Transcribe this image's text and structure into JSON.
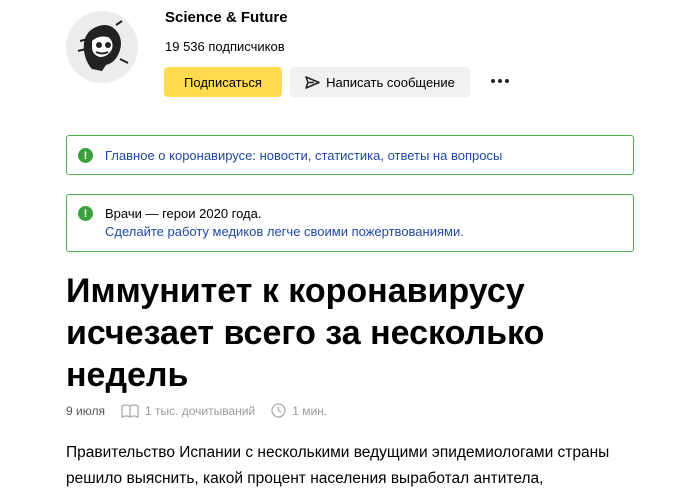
{
  "channel": {
    "name": "Science & Future",
    "subscribers": "19 536 подписчиков",
    "subscribe_label": "Подписаться",
    "message_label": "Написать сообщение"
  },
  "notices": [
    {
      "link": "Главное о коронавирусе: новости, статистика, ответы на вопросы"
    },
    {
      "text": "Врачи — герои 2020 года.",
      "link": "Сделайте работу медиков легче своими пожертвованиями."
    }
  ],
  "article": {
    "title": "Иммунитет к коронавирусу исчезает всего за несколько недель",
    "date": "9 июля",
    "reads": "1 тыс. дочитываний",
    "read_time": "1 мин.",
    "body": "Правительство Испании с несколькими ведущими эпидемиологами страны решило выяснить, какой процент населения выработал антитела,"
  },
  "colors": {
    "accent": "#ffdb4d",
    "notice_border": "#4caf50",
    "link": "#1f47a6"
  }
}
